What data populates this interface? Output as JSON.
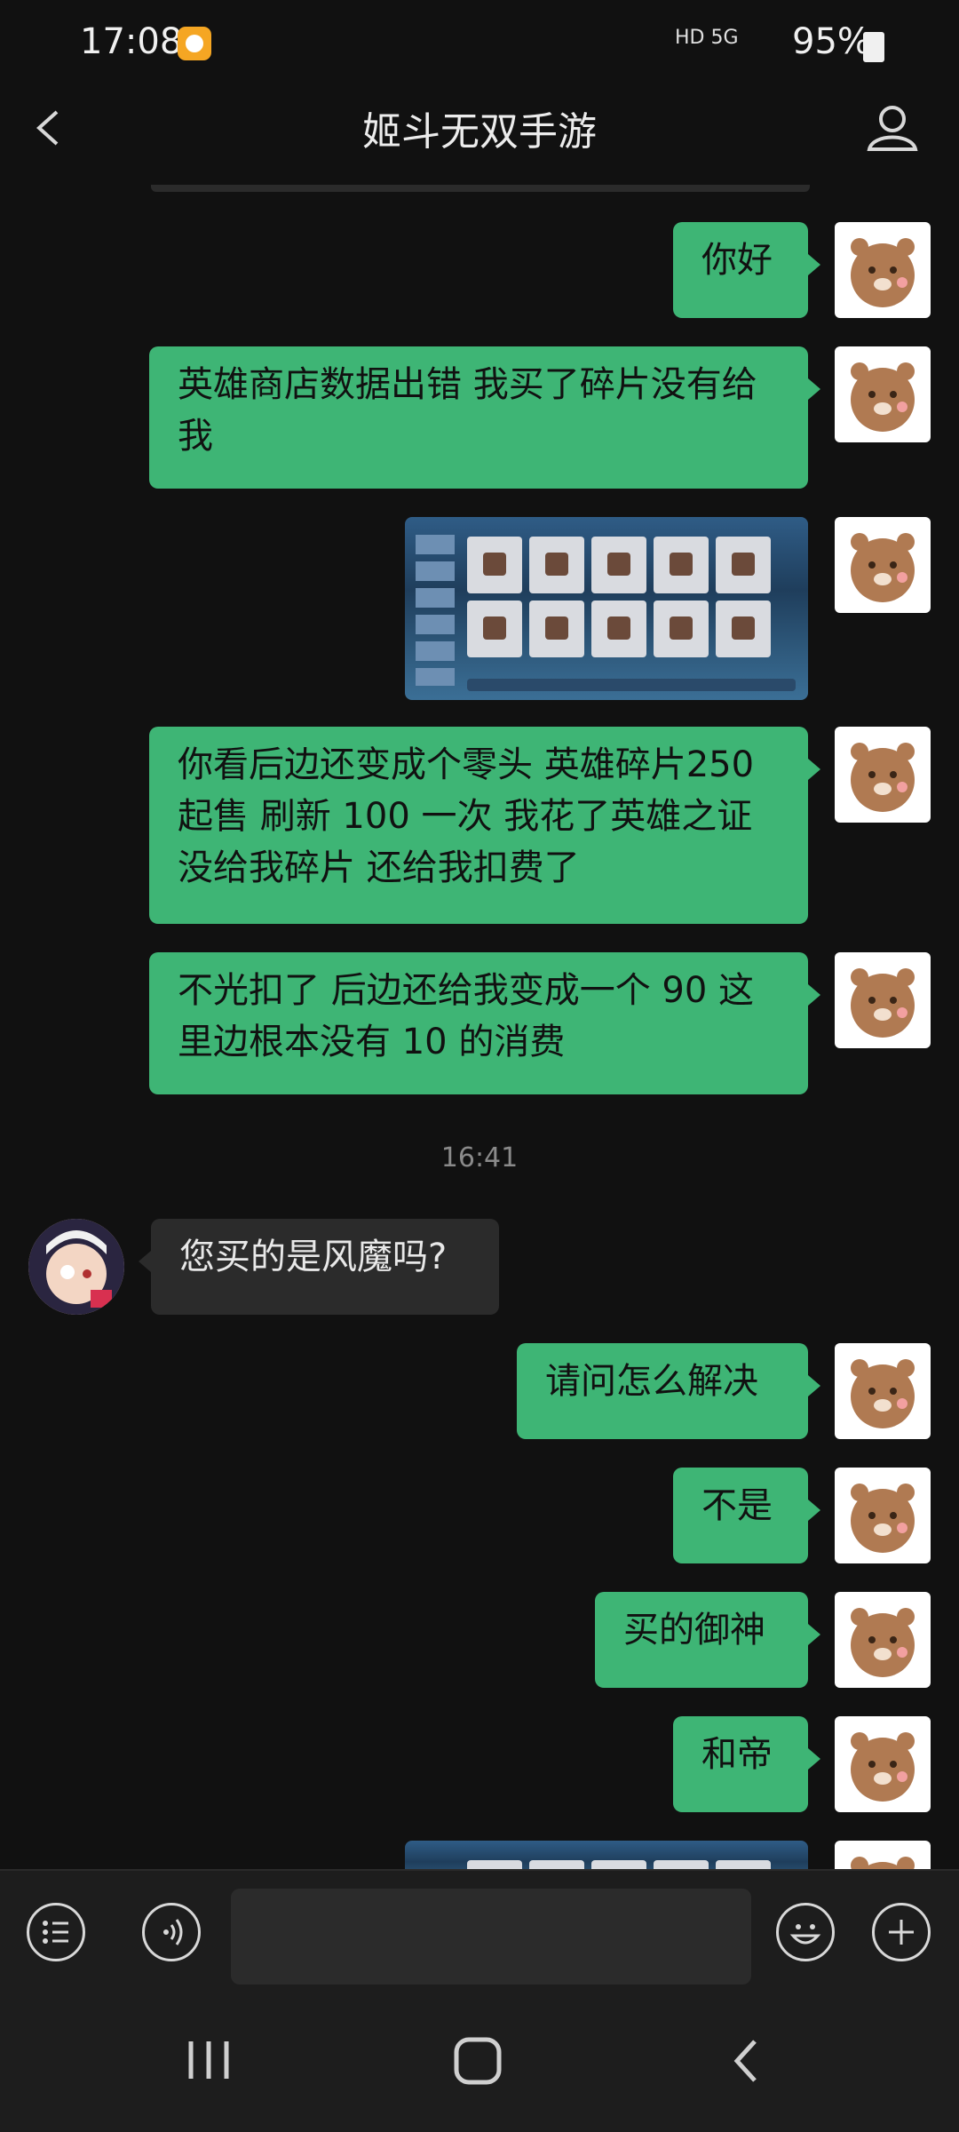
{
  "status_bar": {
    "time": "17:08",
    "network": "HD 5G",
    "battery": "95%"
  },
  "header": {
    "title": "姬斗无双手游"
  },
  "messages": [
    {
      "text": "你好"
    },
    {
      "text": "英雄商店数据出错 我买了碎片没有给我"
    },
    {
      "image": "screenshot"
    },
    {
      "text": "你看后边还变成个零头 英雄碎片250 起售 刷新 100 一次 我花了英雄之证 没给我碎片 还给我扣费了"
    },
    {
      "text": "不光扣了 后边还给我变成一个 90 这里边根本没有 10 的消费"
    },
    {
      "timestamp": "16:41"
    },
    {
      "text": "您买的是风魔吗?"
    },
    {
      "text": "请问怎么解决"
    },
    {
      "text": "不是"
    },
    {
      "text": "买的御神"
    },
    {
      "text": "和帝"
    },
    {
      "image": "screenshot"
    }
  ],
  "input": {
    "value": ""
  },
  "colors": {
    "sent_bubble": "#3eb575",
    "received_bubble": "#2b2b2b",
    "background": "#111111"
  }
}
